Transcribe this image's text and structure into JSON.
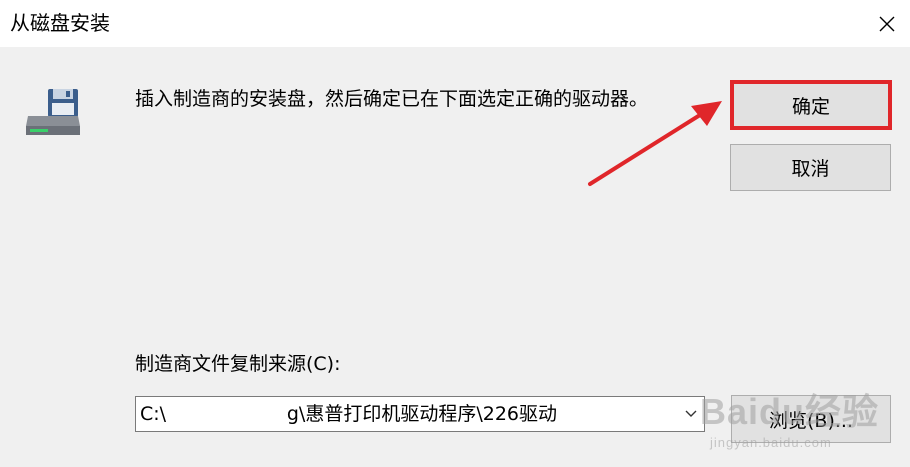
{
  "window": {
    "title": "从磁盘安装",
    "close_icon": "close-icon"
  },
  "message": "插入制造商的安装盘，然后确定已在下面选定正确的驱动器。",
  "buttons": {
    "ok": "确定",
    "cancel": "取消",
    "browse": "浏览(B)..."
  },
  "source": {
    "label": "制造商文件复制来源(C):",
    "value": "C:\\                    g\\惠普打印机驱动程序\\226驱动"
  },
  "icons": {
    "disk": "floppy-disk-drive-icon",
    "dropdown": "chevron-down-icon"
  },
  "annotation": {
    "highlight_color": "#e0262a"
  },
  "watermark": {
    "brand": "Baidu经验",
    "url": "jingyan.baidu.com"
  }
}
